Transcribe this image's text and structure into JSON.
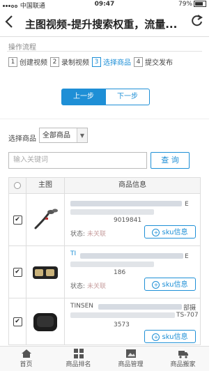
{
  "status_bar": {
    "carrier": "中国联通",
    "time": "09:47",
    "battery": "79%"
  },
  "header": {
    "title": "主图视频-提升搜索权重，流量..."
  },
  "flow": {
    "title": "操作流程",
    "steps": [
      {
        "num": "1",
        "label": "创建视频"
      },
      {
        "num": "2",
        "label": "录制视频"
      },
      {
        "num": "3",
        "label": "选择商品"
      },
      {
        "num": "4",
        "label": "提交发布"
      }
    ]
  },
  "nav": {
    "prev": "上一步",
    "next": "下一步"
  },
  "filter": {
    "label": "选择商品",
    "selected": "全部商品",
    "placeholder": "输入关键词",
    "search": "查 询"
  },
  "table": {
    "headers": {
      "image": "主图",
      "info": "商品信息"
    },
    "rows": [
      {
        "tail_right": "E",
        "tail_bottom": "9019841",
        "status_label": "状态:",
        "status_value": "未关联",
        "sku": "sku信息",
        "checked": "✔"
      },
      {
        "tail_left": "TI",
        "tail_right": "E",
        "tail_bottom": "186",
        "status_label": "状态:",
        "status_value": "未关联",
        "sku": "sku信息",
        "checked": "✔"
      },
      {
        "tail_left": "TINSEN",
        "tail_right": "部摄",
        "tail_right2": "TS-707",
        "tail_bottom": "3573",
        "sku": "sku信息",
        "checked": "✔"
      }
    ]
  },
  "tabbar": [
    "首页",
    "商品排名",
    "商品管理",
    "商品搬家"
  ]
}
